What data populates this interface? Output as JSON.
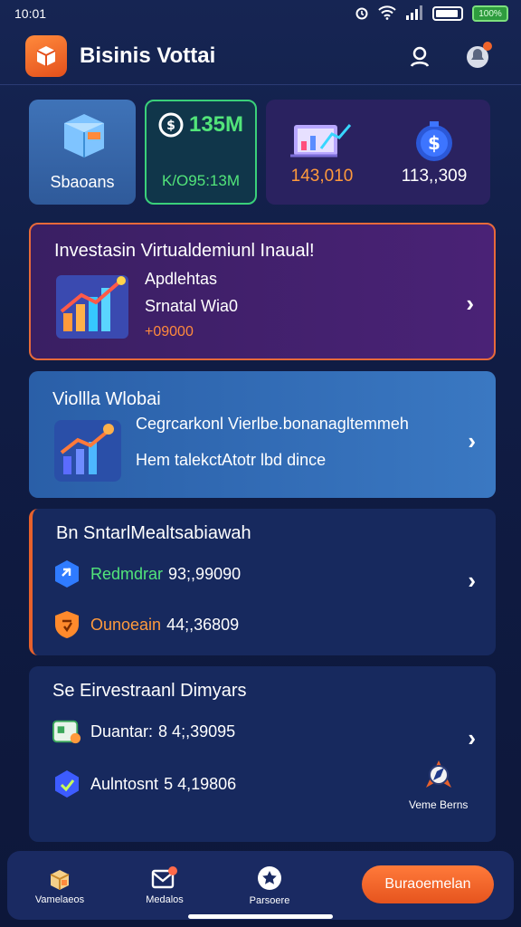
{
  "status": {
    "time": "10:01",
    "battery_text": "100%"
  },
  "app": {
    "title": "Bisinis Vottai"
  },
  "tiles": {
    "t1_label": "Sbaoans",
    "t2_top": "135M",
    "t2_bottom": "K/O95:13M",
    "t3_left_value": "143,010",
    "t3_right_value": "113,,309"
  },
  "card1": {
    "title": "Investasin Virtualdemiunl Inaual!",
    "line1": "Apdlehtas",
    "line2": "Srnatal Wia0",
    "amount": "+09000"
  },
  "card2": {
    "title": "Viollla Wlobai",
    "line1": "Cegrcarkonl Vierlbe.bonanagltemmeh",
    "line2": "Hem talekctAtotr lbd dince"
  },
  "card3": {
    "title": "Bn SntarlMealtsabiawah",
    "row1_label": "Redmdrar",
    "row1_value": "93;,99090",
    "row2_label": "Ounoeain",
    "row2_value": "44;,36809"
  },
  "card4": {
    "title": "Se Eirvestraanl Dimyars",
    "row1_label": "Duantar:",
    "row1_value": "8 4;,39095",
    "row2_label": "Aulntosnt",
    "row2_value": "5 4,19806",
    "side_label": "Veme Berns"
  },
  "nav": {
    "item1": "Vamelaeos",
    "item2": "Medalos",
    "item3": "Parsoere",
    "cta": "Buraoemelan"
  },
  "colors": {
    "accent": "#e8612c",
    "green": "#52e57a",
    "bg": "#101c44"
  }
}
